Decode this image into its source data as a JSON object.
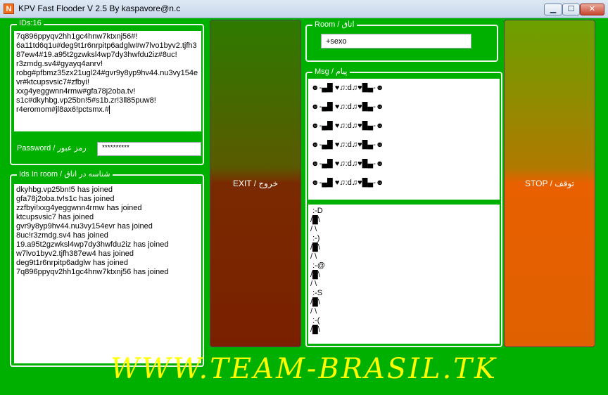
{
  "window": {
    "title": "KPV Fast Flooder V 2.5 By kaspavore@n.c",
    "app_icon_letter": "N",
    "minimize_symbol": "▁",
    "maximize_symbol": "☐",
    "close_symbol": "✕"
  },
  "ids_group": {
    "label": "IDs:16",
    "ids_text": "7q896ppyqv2hh1gc4hnw7ktxnj56#!\n6a11td6q1u#deg9t1r6nrpitp6adglw#w7lvo1byv2.tjfh387ew4#19.a95t2gzwksl4wp7dy3hwfdu2iz#8uc!\nr3zmdg.sv4#gyayq4anrv!\nrobg#pfbmz35zx21ugl24#gvr9y8yp9hv44.nu3vy154evr#ktcupsvsic7#zfbyi!\nxxg4yeggwnn4rmw#gfa78j2oba.tv!\ns1c#dkyhbg.vp25bn!5#s1b.zr!3ll85puw8!\nr4eromom#jl8ax6!pctsmx.#",
    "password_label": "Password / رمز عبور",
    "password_value": "**********"
  },
  "ids_in_room": {
    "label": "Ids In room / شناسه در اتاق",
    "log_lines": [
      "dkyhbg.vp25bn!5 has joined",
      "gfa78j2oba.tv!s1c has joined",
      "zzfbyi!xxg4yeggwnn4rmw has joined",
      "ktcupsvsic7 has joined",
      "gvr9y8yp9hv44.nu3vy154evr has joined",
      "8uc!r3zmdg.sv4 has joined",
      "19.a95t2gzwksl4wp7dy3hwfdu2iz has joined",
      "w7lvo1byv2.tjfh387ew4 has joined",
      "deg9t1r6nrpitp6adglw has joined",
      "7q896ppyqv2hh1gc4hnw7ktxnj56 has joined"
    ]
  },
  "exit_button": {
    "label": "EXIT / خروج"
  },
  "room": {
    "label": "Room / اتاق",
    "value": "+sexo"
  },
  "msg": {
    "label": "Msg / پیام",
    "lines": [
      "☻-▄█ ♥♫:d♫♥█▄-☻",
      "☻-▄█ ♥♫:d♫♥█▄-☻",
      "☻-▄█ ♥♫:d♫♥█▄-☻",
      "☻-▄█ ♥♫:d♫♥█▄-☻",
      "☻-▄█ ♥♫:d♫♥█▄-☻",
      "☻-▄█ ♥♫:d♫♥█▄-☻"
    ],
    "art_text": " :-D\n/█\\\n/ \\\n :-)\n/█\\\n/ \\\n :-@\n/█\\\n/ \\\n :-S\n/█\\\n/ \\\n :-(\n/█\\"
  },
  "stop_button": {
    "label": "STOP / توقف"
  },
  "banner": {
    "text": "WWW.TEAM-BRASIL.TK"
  }
}
